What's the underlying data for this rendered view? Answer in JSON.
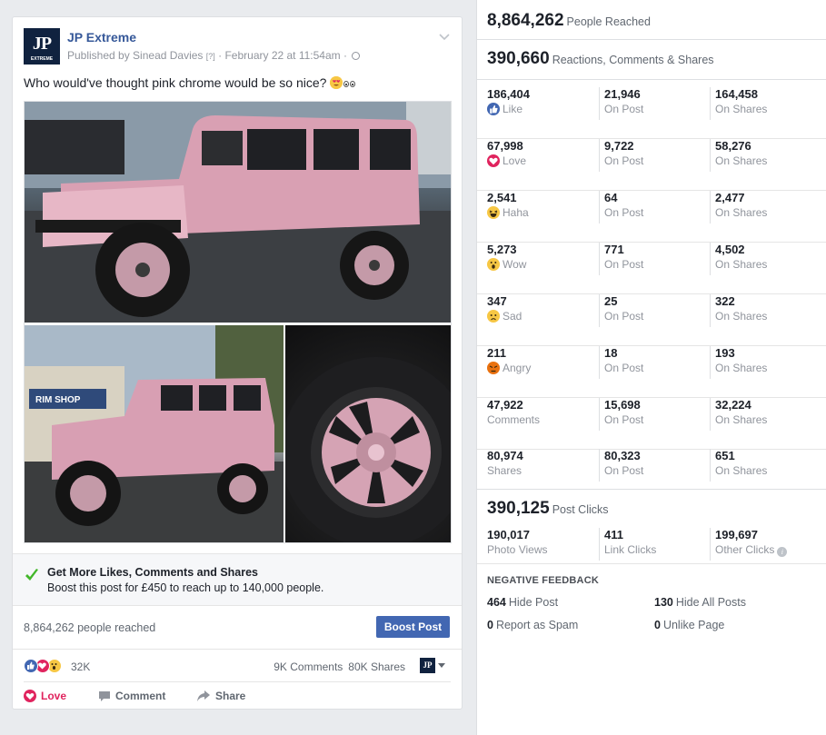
{
  "post": {
    "page_name": "JP Extreme",
    "logo_text": "JP",
    "logo_sub": "EXTREME",
    "published_by": "Published by Sinead Davies",
    "help_mark": "[?]",
    "separator": " · ",
    "date": "February 22 at 11:54am",
    "separator2": " · ",
    "message": "Who would've thought pink chrome would be so nice?",
    "boost": {
      "title": "Get More Likes, Comments and Shares",
      "description": "Boost this post for £450 to reach up to 140,000 people."
    },
    "reach_text": "8,864,262 people reached",
    "boost_button": "Boost Post",
    "reaction_count": "32K",
    "comments_count": "9K Comments",
    "shares_count": "80K Shares",
    "actions": {
      "love": "Love",
      "comment": "Comment",
      "share": "Share"
    },
    "colors": {
      "brand_blue": "#365899",
      "button_blue": "#4267b2",
      "love_red": "#e0245e",
      "pink_jeep": "#e3a6b8"
    }
  },
  "insights": {
    "people_reached": {
      "value": "8,864,262",
      "label": "People Reached"
    },
    "reactions_total": {
      "value": "390,660",
      "label": "Reactions, Comments & Shares"
    },
    "rows": [
      {
        "total": "186,404",
        "type": "Like",
        "icon": "like-icon",
        "on_post": "21,946",
        "on_shares": "164,458"
      },
      {
        "total": "67,998",
        "type": "Love",
        "icon": "love-icon",
        "on_post": "9,722",
        "on_shares": "58,276"
      },
      {
        "total": "2,541",
        "type": "Haha",
        "icon": "haha-icon",
        "on_post": "64",
        "on_shares": "2,477"
      },
      {
        "total": "5,273",
        "type": "Wow",
        "icon": "wow-icon",
        "on_post": "771",
        "on_shares": "4,502"
      },
      {
        "total": "347",
        "type": "Sad",
        "icon": "sad-icon",
        "on_post": "25",
        "on_shares": "322"
      },
      {
        "total": "211",
        "type": "Angry",
        "icon": "angry-icon",
        "on_post": "18",
        "on_shares": "193"
      },
      {
        "total": "47,922",
        "type": "Comments",
        "icon": "",
        "on_post": "15,698",
        "on_shares": "32,224"
      },
      {
        "total": "80,974",
        "type": "Shares",
        "icon": "",
        "on_post": "80,323",
        "on_shares": "651"
      }
    ],
    "on_post_label": "On Post",
    "on_shares_label": "On Shares",
    "post_clicks": {
      "value": "390,125",
      "label": "Post Clicks"
    },
    "clicks": [
      {
        "value": "190,017",
        "label": "Photo Views"
      },
      {
        "value": "411",
        "label": "Link Clicks"
      },
      {
        "value": "199,697",
        "label": "Other Clicks"
      }
    ],
    "negative_feedback": {
      "title": "NEGATIVE FEEDBACK",
      "items": [
        {
          "value": "464",
          "label": "Hide Post"
        },
        {
          "value": "130",
          "label": "Hide All Posts"
        },
        {
          "value": "0",
          "label": "Report as Spam"
        },
        {
          "value": "0",
          "label": "Unlike Page"
        }
      ]
    }
  }
}
